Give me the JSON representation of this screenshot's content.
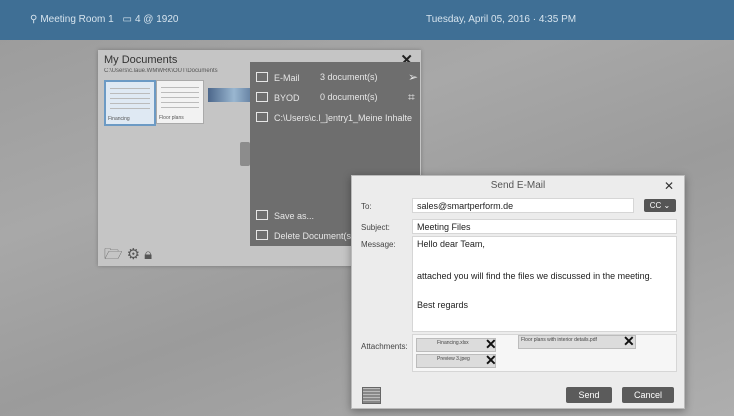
{
  "topbar": {
    "location": "Meeting Room 1",
    "display": "4 @ 1920",
    "datetime": "Tuesday, April 05, 2016 · 4:35 PM"
  },
  "documents_panel": {
    "title": "My Documents",
    "close": "✕",
    "path": "C:\\Users\\c.laue.WMWRK\\OUT\\Documents",
    "thumbnails": [
      {
        "caption": "Financing"
      },
      {
        "caption": "Floor plans"
      }
    ],
    "menu": [
      {
        "label": "E-Mail",
        "count": "3 document(s)",
        "action_icon": "send-icon"
      },
      {
        "label": "BYOD",
        "count": "0 document(s)",
        "action_icon": "qr-icon"
      },
      {
        "label": "C:\\Users\\c.l_]entry1_Meine Inhalte",
        "count": "",
        "action_icon": ""
      }
    ],
    "footer_menu": [
      {
        "label": "Save as..."
      },
      {
        "label": "Delete Document(s)"
      }
    ],
    "toolbar_icons": [
      "folder-open-icon",
      "gear-icon",
      "lock-icon"
    ]
  },
  "email_dialog": {
    "title": "Send E-Mail",
    "close": "✕",
    "to_label": "To:",
    "to_value": "sales@smartperform.de",
    "cc_button": "CC ⌄",
    "subject_label": "Subject:",
    "subject_value": "Meeting Files",
    "message_label": "Message:",
    "message_lines": [
      "Hello dear Team,",
      "attached you will find the files we discussed in the meeting.",
      "Best regards"
    ],
    "attachments_label": "Attachments:",
    "attachments": [
      {
        "name": "Financing.xlsx"
      },
      {
        "name": "Floor plans with interior details.pdf"
      },
      {
        "name": "Preview 3.jpeg"
      }
    ],
    "send_button": "Send",
    "cancel_button": "Cancel"
  }
}
